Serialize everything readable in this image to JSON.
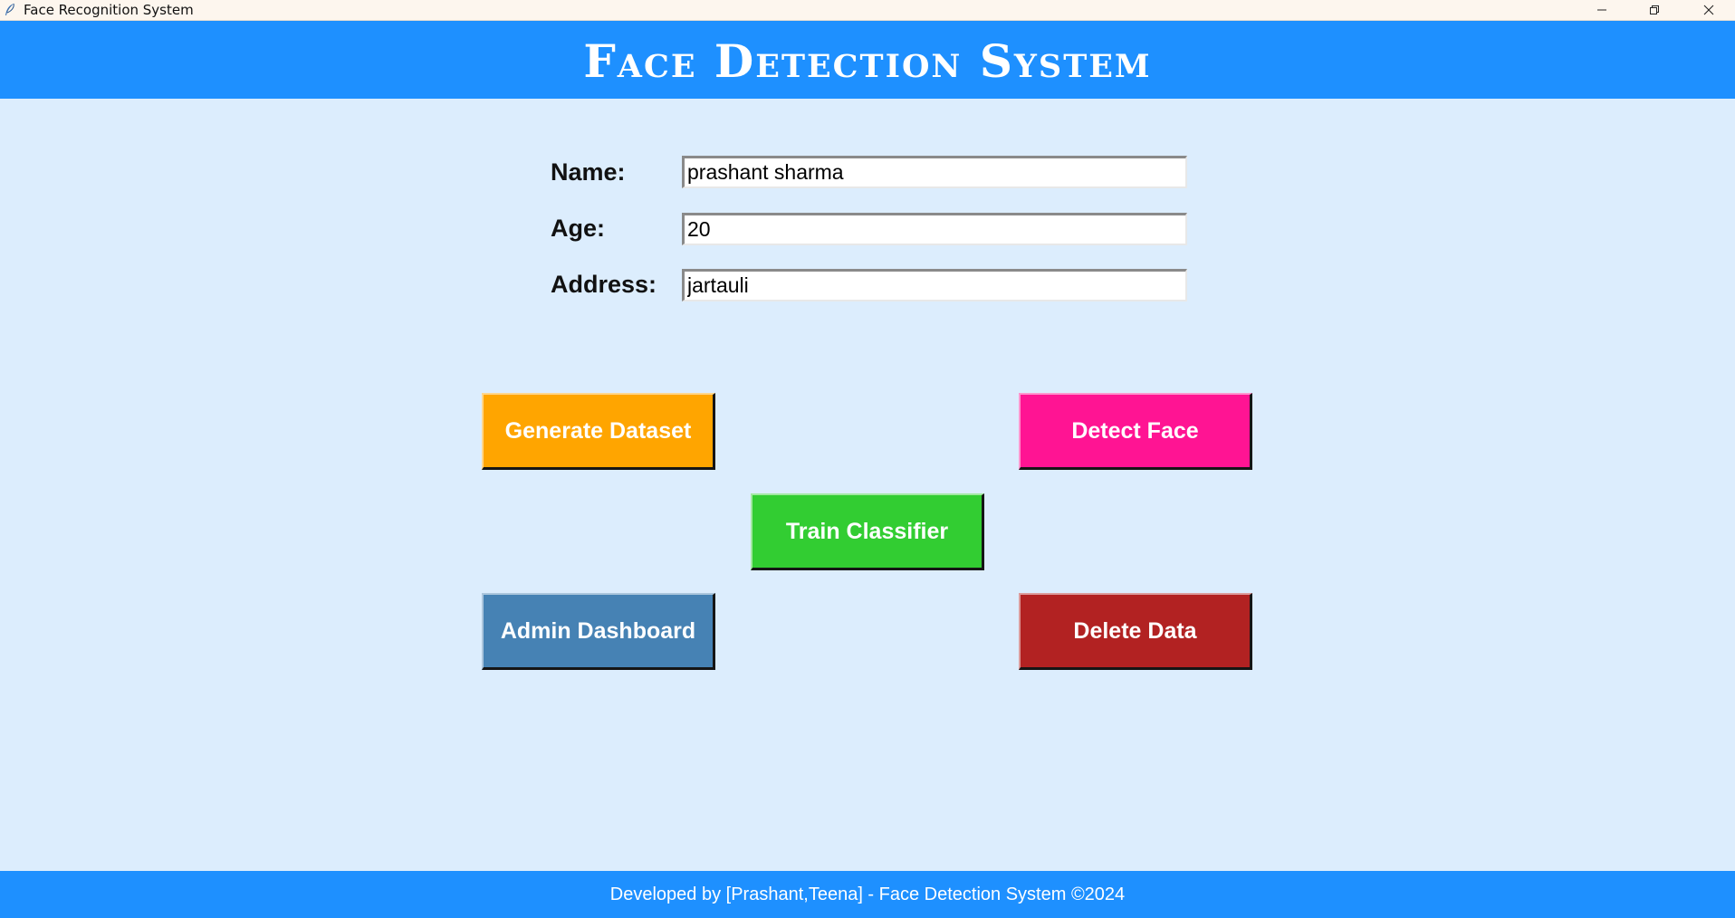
{
  "window": {
    "title": "Face Recognition System",
    "icon": "feather-icon",
    "controls": [
      "minimize-icon",
      "restore-icon",
      "close-icon"
    ]
  },
  "header": {
    "title": "Face Detection System"
  },
  "form": {
    "name_label": "Name:",
    "name_value": "prashant sharma",
    "age_label": "Age:",
    "age_value": "20",
    "address_label": "Address:",
    "address_value": "jartauli"
  },
  "buttons": {
    "generate_dataset": "Generate Dataset",
    "detect_face": "Detect Face",
    "train_classifier": "Train Classifier",
    "admin_dashboard": "Admin Dashboard",
    "delete_data": "Delete Data"
  },
  "footer": {
    "text": "Developed by [Prashant,Teena] - Face Detection System ©2024"
  },
  "colors": {
    "header_bg": "#1e90ff",
    "body_bg": "#dcedfd",
    "generate": "#ffa500",
    "detect": "#ff1493",
    "train": "#32cd32",
    "admin": "#4682b4",
    "delete": "#b22222"
  }
}
